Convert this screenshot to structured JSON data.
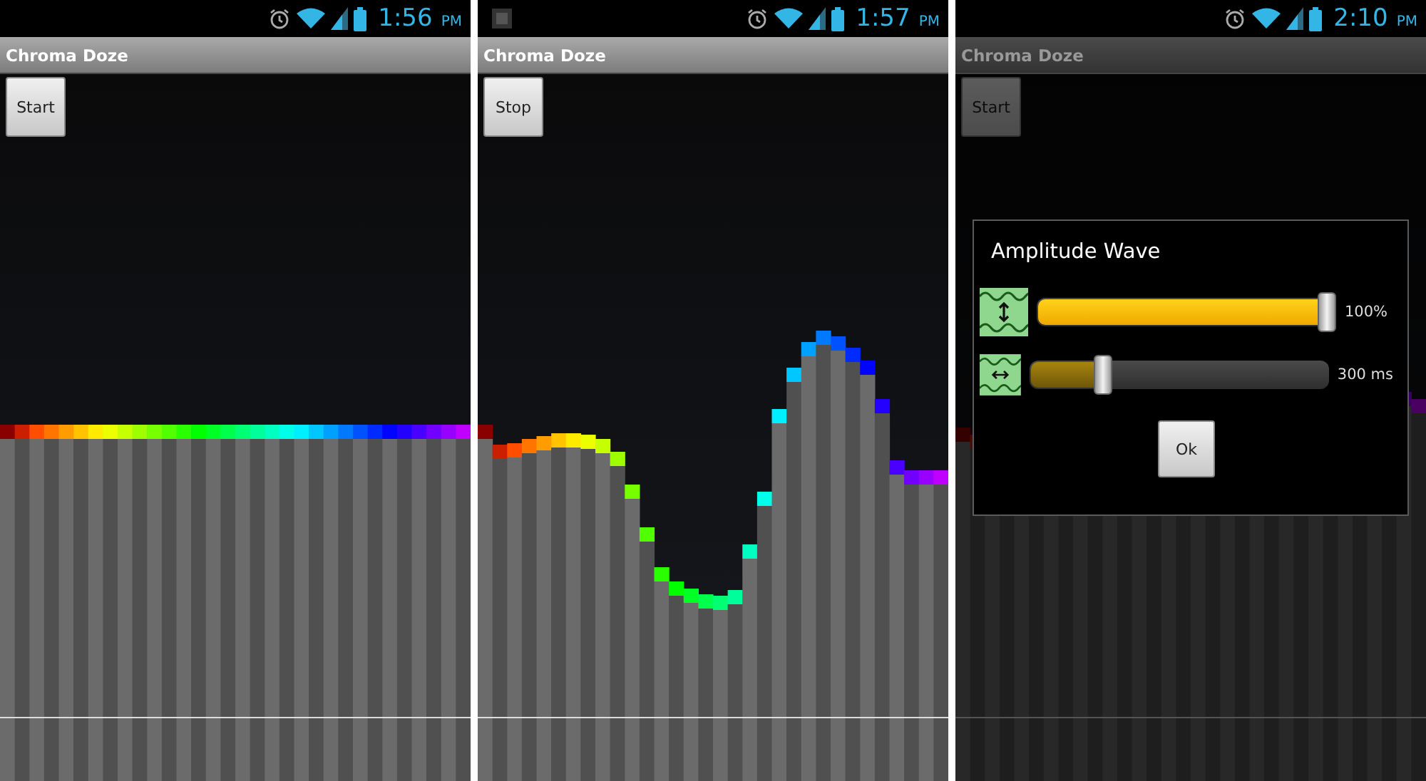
{
  "screens": [
    {
      "status_bar": {
        "time": "1:56",
        "period": "PM",
        "notification": false
      },
      "app_title": "Chroma Doze",
      "button": "Start"
    },
    {
      "status_bar": {
        "time": "1:57",
        "period": "PM",
        "notification": true
      },
      "app_title": "Chroma Doze",
      "button": "Stop"
    },
    {
      "status_bar": {
        "time": "2:10",
        "period": "PM",
        "notification": false
      },
      "app_title": "Chroma Doze",
      "button": "Start",
      "dialog": {
        "title": "Amplitude Wave",
        "sliders": [
          {
            "kind": "amplitude",
            "level": 1.0,
            "reading": "100%"
          },
          {
            "kind": "period",
            "level": 0.23,
            "reading": "300 ms"
          }
        ],
        "button": "Ok"
      }
    }
  ]
}
